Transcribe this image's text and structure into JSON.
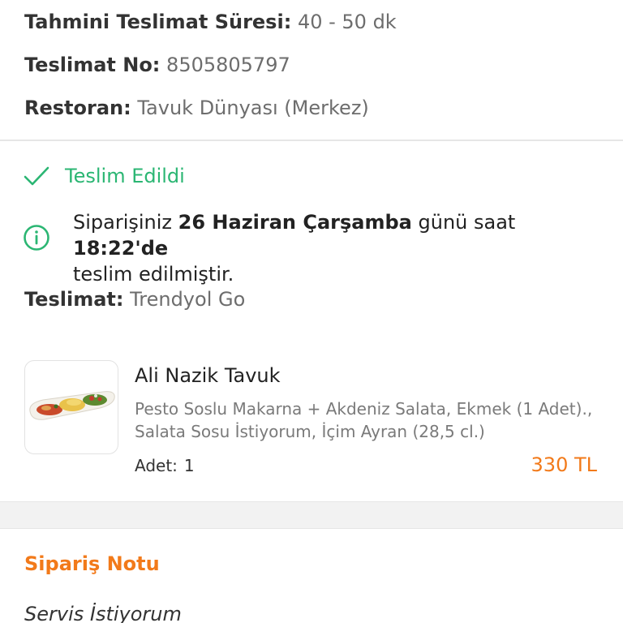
{
  "order_info": {
    "eta_label": "Tahmini Teslimat Süresi:",
    "eta_value": "40 - 50 dk",
    "delivery_no_label": "Teslimat No:",
    "delivery_no_value": "8505805797",
    "restaurant_label": "Restoran:",
    "restaurant_value": "Tavuk Dünyası (Merkez)"
  },
  "status": {
    "icon": "check-icon",
    "label": "Teslim Edildi",
    "color": "#2bb673"
  },
  "notice": {
    "icon": "info-circle-icon",
    "prefix": "Siparişiniz ",
    "date": "26 Haziran Çarşamba",
    "middle": " günü saat ",
    "time": "18:22'de",
    "suffix": "teslim edilmiştir."
  },
  "delivery": {
    "label": "Teslimat:",
    "value": "Trendyol Go"
  },
  "product": {
    "name": "Ali Nazik Tavuk",
    "description": "Pesto Soslu Makarna + Akdeniz Salata, Ekmek (1 Adet)., Salata Sosu İstiyorum, İçim Ayran (28,5 cl.)",
    "qty_label": "Adet:",
    "qty_value": "1",
    "price": "330 TL",
    "price_color": "#f27a1a"
  },
  "order_note": {
    "title": "Sipariş Notu",
    "text": "Servis İstiyorum"
  }
}
